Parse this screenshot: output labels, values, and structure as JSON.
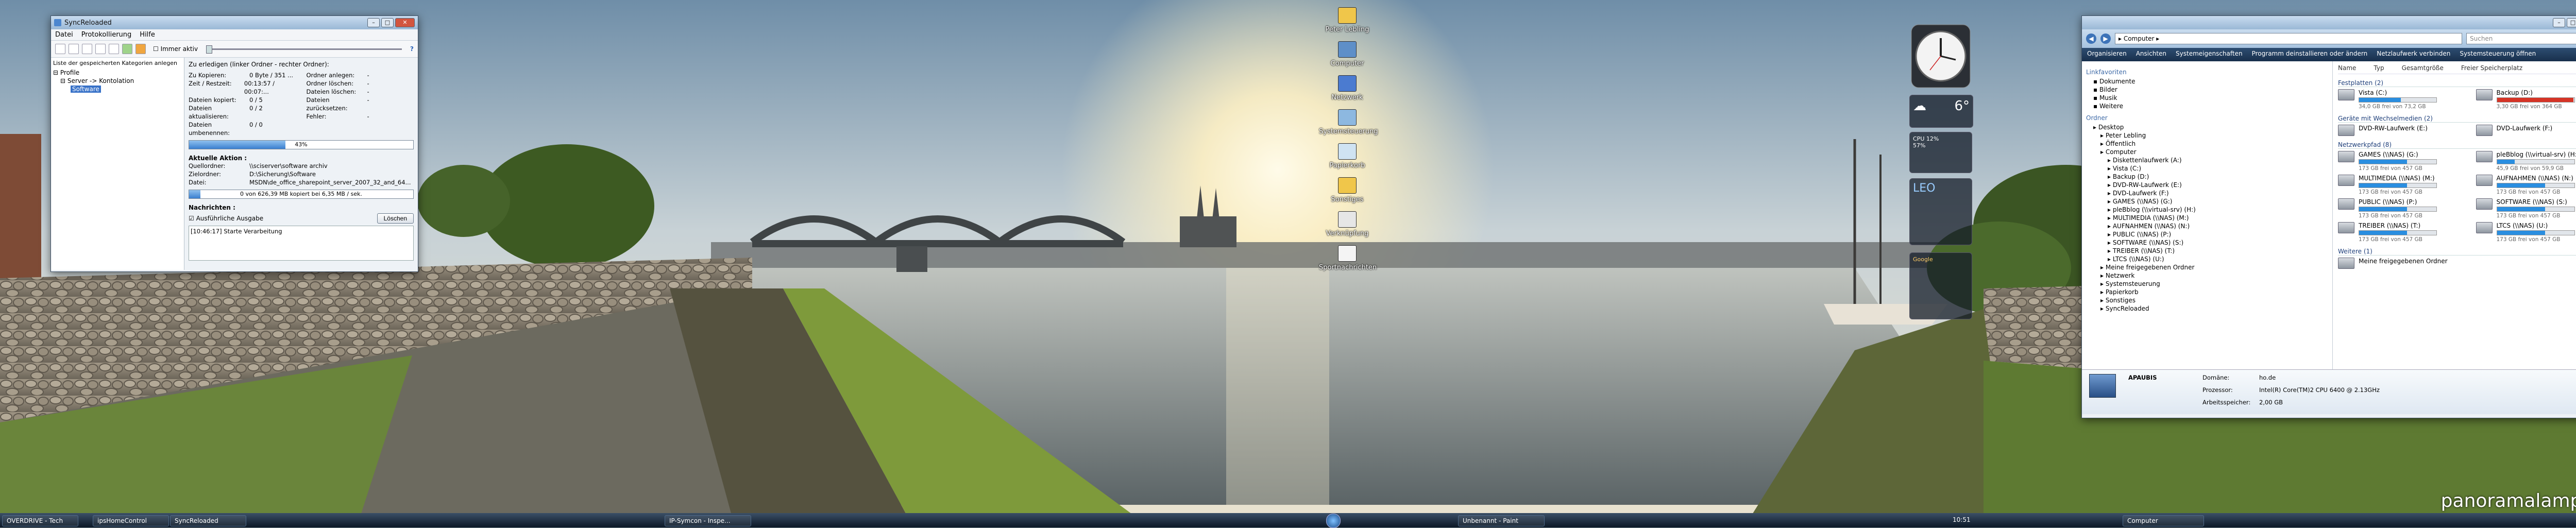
{
  "colors": {
    "sky_top": "#8aa5bb",
    "sun": "#fff6d8",
    "water": "#7f8c90",
    "wall": "#8b8378",
    "grass": "#5d7a2e",
    "accent": "#3872c8"
  },
  "desktop_icons": [
    {
      "label": "Peter Lebling",
      "icon": "folder-icon"
    },
    {
      "label": "Computer",
      "icon": "computer-icon"
    },
    {
      "label": "Netzwerk",
      "icon": "network-icon"
    },
    {
      "label": "Systemsteuerung",
      "icon": "control-panel-icon"
    },
    {
      "label": "Papierkorb",
      "icon": "recycle-bin-icon"
    },
    {
      "label": "Sonstiges",
      "icon": "folder-icon"
    },
    {
      "label": "Verknüpfung",
      "icon": "shortcut-icon"
    },
    {
      "label": "Sportnachrichten",
      "icon": "document-icon"
    }
  ],
  "sync": {
    "title": "SyncReloaded",
    "menu": [
      "Datei",
      "Protokollierung",
      "Hilfe"
    ],
    "toolbar_checkbox": "Immer aktiv",
    "left_header": "Liste der gespeicherten Kategorien anlegen",
    "tree": [
      "Profile",
      "Server -> Kontolation",
      "Software"
    ],
    "right_header": "Zu erledigen (linker Ordner - rechter Ordner):",
    "stats_left": [
      [
        "Zu Kopieren:",
        "0 Byte / 351 ..."
      ],
      [
        "Zeit / Restzeit:",
        "00:13:57 / 00:07:..."
      ],
      [
        "Dateien kopiert:",
        "0 / 5"
      ],
      [
        "Dateien aktualisieren:",
        "0 / 2"
      ],
      [
        "Dateien umbenennen:",
        "0 / 0"
      ]
    ],
    "stats_right": [
      [
        "Ordner anlegen:",
        "-"
      ],
      [
        "Ordner löschen:",
        "-"
      ],
      [
        "Dateien löschen:",
        "-"
      ],
      [
        "Dateien zurücksetzen:",
        "-"
      ],
      [
        "Fehler:",
        "-"
      ]
    ],
    "progress_total": 0.43,
    "progress_total_label": "43%",
    "action_title": "Aktuelle Aktion :",
    "action": [
      [
        "Quellordner:",
        "\\\\sciserver\\software archiv"
      ],
      [
        "Zielordner:",
        "D:\\Sicherung\\Software"
      ],
      [
        "Datei:",
        "MSDN\\de_office_sharepoint_server_2007_32_and_64..."
      ]
    ],
    "progress_file": 0.05,
    "progress_file_label": "0 von 626,39 MB kopiert bei 6,35 MB / sek.",
    "messages_title": "Nachrichten :",
    "messages_checkbox": "Ausführliche Ausgabe",
    "clear_button": "Löschen",
    "log": "[10:46:17] Starte Verarbeitung"
  },
  "gadgets": {
    "weather_temp": "6°",
    "cpu_label": "CPU",
    "cpu_value": "12%",
    "ram_value": "57%",
    "feed_title": "LEO",
    "search_label": "Google"
  },
  "explorer": {
    "address": "▸ Computer ▸",
    "search_placeholder": "Suchen",
    "commands": [
      "Organisieren",
      "Ansichten",
      "Systemeigenschaften",
      "Programm deinstallieren oder ändern",
      "Netzlaufwerk verbinden",
      "Systemsteuerung öffnen"
    ],
    "favorites_title": "Linkfavoriten",
    "favorites": [
      "Dokumente",
      "Bilder",
      "Musik",
      "Weitere"
    ],
    "folders_title": "Ordner",
    "tree": [
      "Desktop",
      "Peter Lebling",
      "Öffentlich",
      "Computer",
      "Diskettenlaufwerk (A:)",
      "Vista (C:)",
      "Backup (D:)",
      "DVD-RW-Laufwerk (E:)",
      "DVD-Laufwerk (F:)",
      "GAMES (\\\\NAS) (G:)",
      "pleBblog (\\\\virtual-srv) (H:)",
      "MULTIMEDIA (\\\\NAS) (M:)",
      "AUFNAHMEN (\\\\NAS) (N:)",
      "PUBLIC (\\\\NAS) (P:)",
      "SOFTWARE (\\\\NAS) (S:)",
      "TREIBER (\\\\NAS) (T:)",
      "LTCS (\\\\NAS) (U:)",
      "Meine freigegebenen Ordner",
      "Netzwerk",
      "Systemsteuerung",
      "Papierkorb",
      "Sonstiges",
      "SyncReloaded"
    ],
    "columns": [
      "Name",
      "Typ",
      "Gesamtgröße",
      "Freier Speicherplatz"
    ],
    "groups": {
      "hdd": "Festplatten (2)",
      "removable": "Geräte mit Wechselmedien (2)",
      "network": "Netzwerkpfad (8)",
      "other": "Weitere (1)"
    },
    "hdd": [
      {
        "name": "Vista (C:)",
        "sub": "34,0 GB frei von 73,2 GB",
        "used": 0.54,
        "full": false
      },
      {
        "name": "Backup (D:)",
        "sub": "3,30 GB frei von 364 GB",
        "used": 0.99,
        "full": true
      }
    ],
    "removable": [
      {
        "name": "DVD-RW-Laufwerk (E:)"
      },
      {
        "name": "DVD-Laufwerk (F:)"
      }
    ],
    "network": [
      {
        "name": "GAMES (\\\\NAS) (G:)",
        "sub": "173 GB frei von 457 GB",
        "used": 0.62
      },
      {
        "name": "pleBblog (\\\\virtual-srv) (H:)",
        "sub": "45,9 GB frei von 59,9 GB",
        "used": 0.23
      },
      {
        "name": "MULTIMEDIA (\\\\NAS) (M:)",
        "sub": "173 GB frei von 457 GB",
        "used": 0.62
      },
      {
        "name": "AUFNAHMEN (\\\\NAS) (N:)",
        "sub": "173 GB frei von 457 GB",
        "used": 0.62
      },
      {
        "name": "PUBLIC (\\\\NAS) (P:)",
        "sub": "173 GB frei von 457 GB",
        "used": 0.62
      },
      {
        "name": "SOFTWARE (\\\\NAS) (S:)",
        "sub": "173 GB frei von 457 GB",
        "used": 0.62
      },
      {
        "name": "TREIBER (\\\\NAS) (T:)",
        "sub": "173 GB frei von 457 GB",
        "used": 0.62
      },
      {
        "name": "LTCS (\\\\NAS) (U:)",
        "sub": "173 GB frei von 457 GB",
        "used": 0.62
      }
    ],
    "other": [
      {
        "name": "Meine freigegebenen Ordner"
      }
    ],
    "details": {
      "pc_name": "APAUBIS",
      "k1": "Domäne:",
      "v1": "ho.de",
      "k2": "Prozessor:",
      "v2": "Intel(R) Core(TM)2 CPU     6400  @ 2.13GHz",
      "k3": "Arbeitsspeicher:",
      "v3": "2,00 GB"
    }
  },
  "taskbar": {
    "left": [
      "OVERDRIVE - Tech",
      "ipsHomeControl",
      "SyncReloaded"
    ],
    "middle": [
      "IP-Symcon - Inspe...",
      "Unbenannt - Paint"
    ],
    "right": [
      "Computer"
    ],
    "clock": "10:51"
  },
  "watermark": "panoramalampe.de"
}
